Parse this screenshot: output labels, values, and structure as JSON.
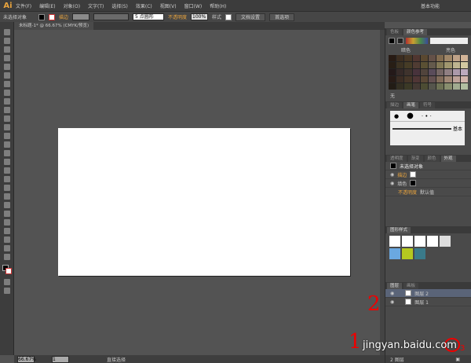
{
  "app": {
    "logo": "Ai",
    "workspace": "基本功能"
  },
  "menu": [
    "文件(F)",
    "编辑(E)",
    "对象(O)",
    "文字(T)",
    "选择(S)",
    "效果(C)",
    "视图(V)",
    "窗口(W)",
    "帮助(H)"
  ],
  "control": {
    "selection": "未选择对象",
    "stroke": "描边",
    "brush": "5 点圆形",
    "opacity": "不透明度",
    "opacity_value": "100%",
    "style": "样式",
    "doc_setup": "文档设置",
    "prefs": "首选项"
  },
  "document": {
    "tab": "未标题-1* @ 66.67% (CMYK/预览)"
  },
  "swatches": {
    "tabs": [
      "色板",
      "颜色参考"
    ],
    "dark": "暗色",
    "light": "亮色",
    "none": "无"
  },
  "brushes": {
    "tabs": [
      "描边",
      "画笔",
      "符号"
    ],
    "basic": "基本"
  },
  "appearance": {
    "tabs": [
      "透明度",
      "渐变",
      "颜色",
      "外观"
    ],
    "title": "未选择对象",
    "stroke": "描边",
    "fill": "填色",
    "opacity": "不透明度",
    "opacity_value": "默认值"
  },
  "graphic_styles": {
    "title": "图形样式"
  },
  "layers": {
    "tabs": [
      "图层",
      "画板"
    ],
    "items": [
      "图层 2",
      "图层 1"
    ],
    "count": "2 图层"
  },
  "status": {
    "zoom": "66.67%",
    "page": "1",
    "tool": "直接选择"
  },
  "annotations": {
    "one": "1",
    "two": "2",
    "three": "3"
  },
  "watermark": "jingyan.baidu.com"
}
